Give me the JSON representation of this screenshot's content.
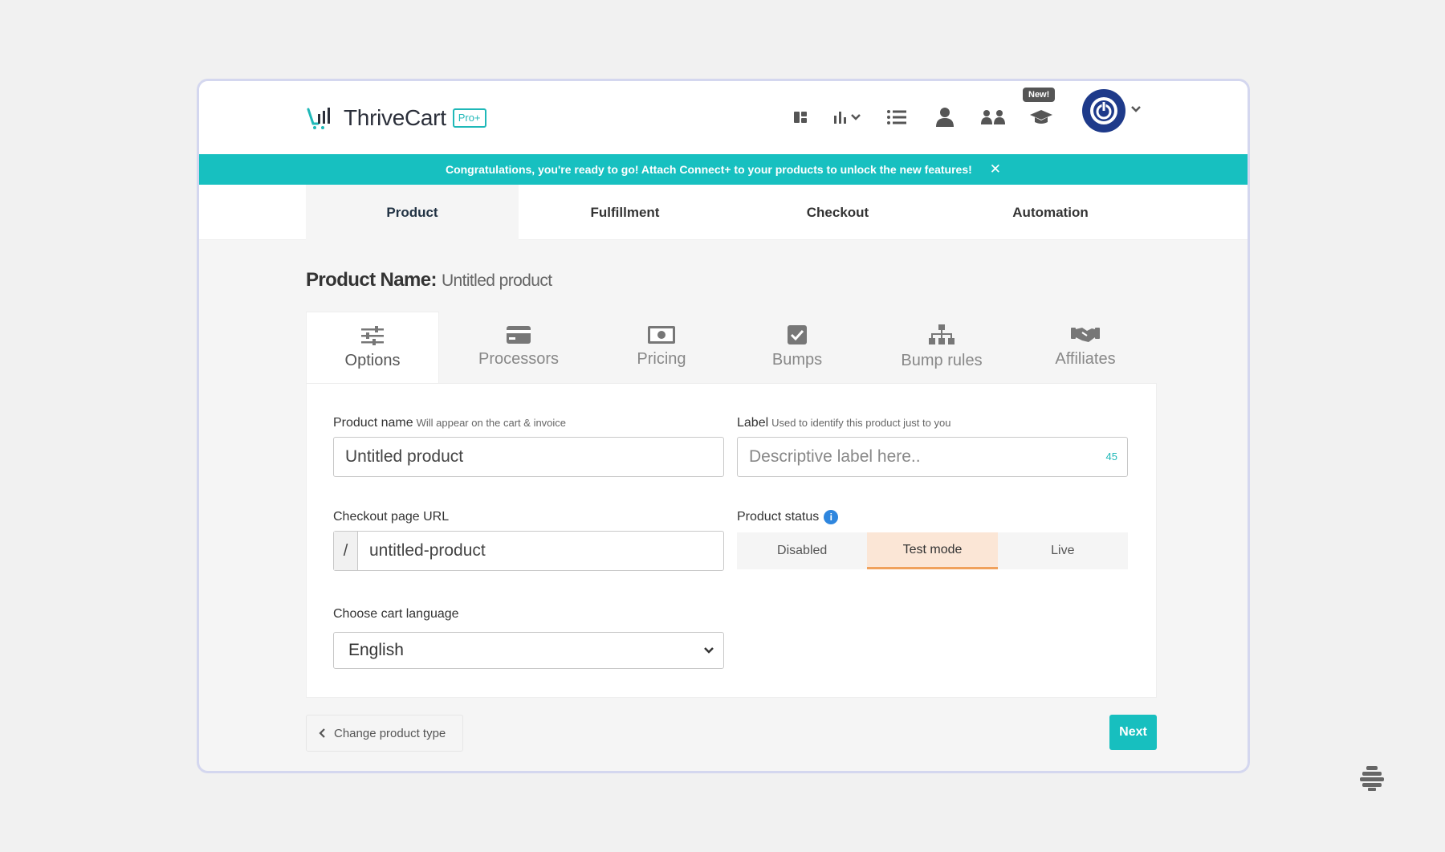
{
  "header": {
    "logo_text": "ThriveCart",
    "logo_badge": "Pro+",
    "new_badge": "New!",
    "nav_icons": [
      "dashboard-icon",
      "analytics-icon",
      "list-icon",
      "user-icon",
      "affiliates-icon",
      "learn-icon"
    ]
  },
  "banner": {
    "message": "Congratulations, you're ready to go!  Attach Connect+ to your products to unlock the new features!",
    "close": "✕"
  },
  "main_tabs": [
    {
      "label": "Product",
      "active": true
    },
    {
      "label": "Fulfillment",
      "active": false
    },
    {
      "label": "Checkout",
      "active": false
    },
    {
      "label": "Automation",
      "active": false
    }
  ],
  "product_title": {
    "label": "Product Name:",
    "value": "Untitled product"
  },
  "sub_tabs": [
    {
      "label": "Options",
      "icon": "sliders-icon",
      "active": true
    },
    {
      "label": "Processors",
      "icon": "credit-card-icon",
      "active": false
    },
    {
      "label": "Pricing",
      "icon": "money-icon",
      "active": false
    },
    {
      "label": "Bumps",
      "icon": "checkbox-icon",
      "active": false
    },
    {
      "label": "Bump rules",
      "icon": "sitemap-icon",
      "active": false
    },
    {
      "label": "Affiliates",
      "icon": "handshake-icon",
      "active": false
    }
  ],
  "form": {
    "product_name": {
      "label": "Product name",
      "hint": "Will appear on the cart & invoice",
      "value": "Untitled product"
    },
    "label": {
      "label": "Label",
      "hint": "Used to identify this product just to you",
      "placeholder": "Descriptive label here..",
      "counter": "45"
    },
    "checkout_url": {
      "label": "Checkout page URL",
      "prefix": "/",
      "value": "untitled-product"
    },
    "product_status": {
      "label": "Product status",
      "info": "i",
      "options": [
        "Disabled",
        "Test mode",
        "Live"
      ],
      "selected": "Test mode"
    },
    "language": {
      "label": "Choose cart language",
      "value": "English"
    }
  },
  "footer": {
    "back_label": "Change product type",
    "next_label": "Next"
  },
  "colors": {
    "accent": "#17c0c0",
    "active_status": "#fbe6d6",
    "active_status_border": "#f0a15c",
    "avatar": "#1e3a8a"
  }
}
